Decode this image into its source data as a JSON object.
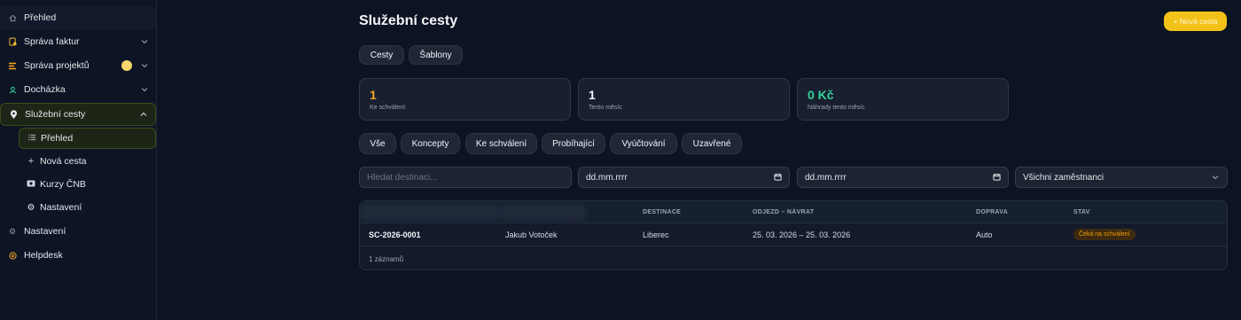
{
  "sidebar": {
    "items": [
      {
        "label": "Přehled",
        "icon": "home-icon"
      },
      {
        "label": "Správa faktur",
        "icon": "invoice-icon"
      },
      {
        "label": "Správa projektů",
        "icon": "projects-icon"
      },
      {
        "label": "Docházka",
        "icon": "user-icon"
      },
      {
        "label": "Služební cesty",
        "icon": "location-pin-icon"
      },
      {
        "label": "Nastavení",
        "icon": "settings-icon"
      },
      {
        "label": "Helpdesk",
        "icon": "help-icon"
      }
    ],
    "subitems": [
      {
        "label": "Přehled",
        "icon": "list-icon"
      },
      {
        "label": "Nová cesta",
        "icon": "plus-icon"
      },
      {
        "label": "Kurzy ČNB",
        "icon": "currency-icon"
      },
      {
        "label": "Nastavení",
        "icon": "gear-icon"
      }
    ]
  },
  "page": {
    "title": "Služební cesty",
    "new_button": "+ Nová cesta"
  },
  "tabs": [
    "Cesty",
    "Šablony"
  ],
  "stats": [
    {
      "value": "1",
      "caption": "Ke schválení",
      "color": "#f5a623"
    },
    {
      "value": "1",
      "caption": "Tento měsíc",
      "color": "#f3f4f6"
    },
    {
      "value": "0 Kč",
      "caption": "Náhrady tento měsíc",
      "color": "#34d399"
    }
  ],
  "filters": [
    "Vše",
    "Koncepty",
    "Ke schválení",
    "Probíhající",
    "Vyúčtování",
    "Uzavřené"
  ],
  "search": {
    "placeholder": "Hledat destinaci...",
    "date_from": "dd.mm.rrrr",
    "date_to": "dd.mm.rrrr",
    "employee_select": "Všichni zaměstnanci"
  },
  "table": {
    "headers": [
      "DESTINACE",
      "ODJEZD – NÁVRAT",
      "DOPRAVA",
      "STAV"
    ],
    "rows": [
      {
        "id": "SC-2026-0001",
        "employee": "Jakub Votoček",
        "destination": "Liberec",
        "dates": "25. 03. 2026 – 25. 03. 2026",
        "transport": "Auto",
        "status": "Čeká na schválení"
      }
    ],
    "footer": "1 záznamů"
  }
}
